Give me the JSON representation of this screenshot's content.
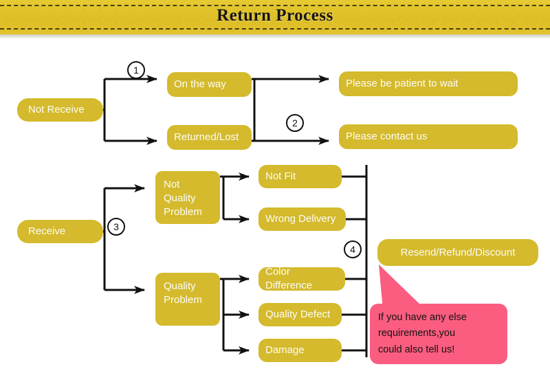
{
  "header": {
    "title": "Return Process",
    "banner_color": "#e3c62b"
  },
  "theme": {
    "node_fill": "#d4ba2c",
    "node_text": "#fdfcf5",
    "line_color": "#111111",
    "callout_fill": "#fa5d80",
    "callout_text": "#18120f"
  },
  "flow": {
    "roots": [
      {
        "id": "not-receive",
        "label": "Not Receive"
      },
      {
        "id": "receive",
        "label": "Receive"
      }
    ],
    "branches": [
      {
        "id": "on-the-way",
        "label": "On the way"
      },
      {
        "id": "returned-lost",
        "label": "Returned/Lost"
      },
      {
        "id": "not-quality-problem",
        "label": "Not\nQuality\nProblem"
      },
      {
        "id": "quality-problem",
        "label": "Quality\nProblem"
      }
    ],
    "leaves": [
      {
        "id": "not-fit",
        "label": "Not Fit"
      },
      {
        "id": "wrong-delivery",
        "label": "Wrong Delivery"
      },
      {
        "id": "color-difference",
        "label": "Color Difference"
      },
      {
        "id": "quality-defect",
        "label": "Quality Defect"
      },
      {
        "id": "damage",
        "label": "Damage"
      }
    ],
    "outcomes": [
      {
        "id": "please-wait",
        "label": "Please be patient to wait"
      },
      {
        "id": "please-contact",
        "label": "Please contact us"
      },
      {
        "id": "resend-refund",
        "label": "Resend/Refund/Discount"
      }
    ],
    "steps": [
      {
        "id": "step-1",
        "label": "1"
      },
      {
        "id": "step-2",
        "label": "2"
      },
      {
        "id": "step-3",
        "label": "3"
      },
      {
        "id": "step-4",
        "label": "4"
      }
    ]
  },
  "callout": {
    "line1": "If you have any else",
    "line2": "requirements,you",
    "line3": "could also tell us!"
  }
}
